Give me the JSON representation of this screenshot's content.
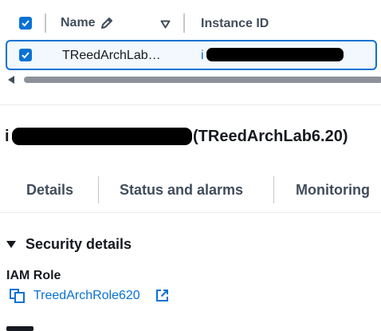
{
  "table": {
    "columns": [
      {
        "label": "Name"
      },
      {
        "label": "Instance ID"
      }
    ],
    "rows": [
      {
        "name": "TReedArchLab…",
        "instance_id_prefix": "i"
      }
    ]
  },
  "instance": {
    "id_prefix": "i",
    "name_suffix": "(TReedArchLab6.20)"
  },
  "tabs": [
    {
      "label": "Details"
    },
    {
      "label": "Status and alarms"
    },
    {
      "label": "Monitoring"
    }
  ],
  "security": {
    "section_title": "Security details",
    "iam_label": "IAM Role",
    "iam_role": "TreedArchRole620"
  },
  "colors": {
    "accent": "#0972d3",
    "text": "#16191f",
    "muted": "#414d5c"
  }
}
